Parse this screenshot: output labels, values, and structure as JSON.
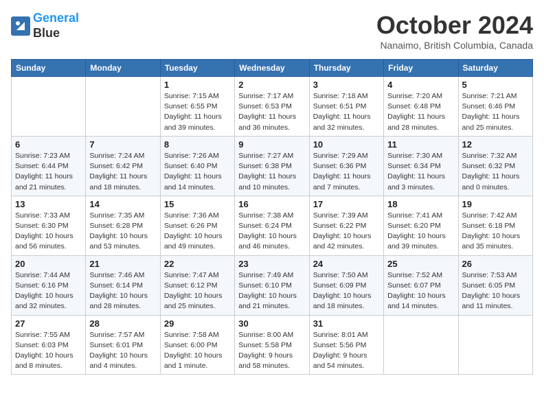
{
  "header": {
    "logo_line1": "General",
    "logo_line2": "Blue",
    "month": "October 2024",
    "location": "Nanaimo, British Columbia, Canada"
  },
  "weekdays": [
    "Sunday",
    "Monday",
    "Tuesday",
    "Wednesday",
    "Thursday",
    "Friday",
    "Saturday"
  ],
  "weeks": [
    [
      {
        "day": "",
        "info": ""
      },
      {
        "day": "",
        "info": ""
      },
      {
        "day": "1",
        "info": "Sunrise: 7:15 AM\nSunset: 6:55 PM\nDaylight: 11 hours and 39 minutes."
      },
      {
        "day": "2",
        "info": "Sunrise: 7:17 AM\nSunset: 6:53 PM\nDaylight: 11 hours and 36 minutes."
      },
      {
        "day": "3",
        "info": "Sunrise: 7:18 AM\nSunset: 6:51 PM\nDaylight: 11 hours and 32 minutes."
      },
      {
        "day": "4",
        "info": "Sunrise: 7:20 AM\nSunset: 6:48 PM\nDaylight: 11 hours and 28 minutes."
      },
      {
        "day": "5",
        "info": "Sunrise: 7:21 AM\nSunset: 6:46 PM\nDaylight: 11 hours and 25 minutes."
      }
    ],
    [
      {
        "day": "6",
        "info": "Sunrise: 7:23 AM\nSunset: 6:44 PM\nDaylight: 11 hours and 21 minutes."
      },
      {
        "day": "7",
        "info": "Sunrise: 7:24 AM\nSunset: 6:42 PM\nDaylight: 11 hours and 18 minutes."
      },
      {
        "day": "8",
        "info": "Sunrise: 7:26 AM\nSunset: 6:40 PM\nDaylight: 11 hours and 14 minutes."
      },
      {
        "day": "9",
        "info": "Sunrise: 7:27 AM\nSunset: 6:38 PM\nDaylight: 11 hours and 10 minutes."
      },
      {
        "day": "10",
        "info": "Sunrise: 7:29 AM\nSunset: 6:36 PM\nDaylight: 11 hours and 7 minutes."
      },
      {
        "day": "11",
        "info": "Sunrise: 7:30 AM\nSunset: 6:34 PM\nDaylight: 11 hours and 3 minutes."
      },
      {
        "day": "12",
        "info": "Sunrise: 7:32 AM\nSunset: 6:32 PM\nDaylight: 11 hours and 0 minutes."
      }
    ],
    [
      {
        "day": "13",
        "info": "Sunrise: 7:33 AM\nSunset: 6:30 PM\nDaylight: 10 hours and 56 minutes."
      },
      {
        "day": "14",
        "info": "Sunrise: 7:35 AM\nSunset: 6:28 PM\nDaylight: 10 hours and 53 minutes."
      },
      {
        "day": "15",
        "info": "Sunrise: 7:36 AM\nSunset: 6:26 PM\nDaylight: 10 hours and 49 minutes."
      },
      {
        "day": "16",
        "info": "Sunrise: 7:38 AM\nSunset: 6:24 PM\nDaylight: 10 hours and 46 minutes."
      },
      {
        "day": "17",
        "info": "Sunrise: 7:39 AM\nSunset: 6:22 PM\nDaylight: 10 hours and 42 minutes."
      },
      {
        "day": "18",
        "info": "Sunrise: 7:41 AM\nSunset: 6:20 PM\nDaylight: 10 hours and 39 minutes."
      },
      {
        "day": "19",
        "info": "Sunrise: 7:42 AM\nSunset: 6:18 PM\nDaylight: 10 hours and 35 minutes."
      }
    ],
    [
      {
        "day": "20",
        "info": "Sunrise: 7:44 AM\nSunset: 6:16 PM\nDaylight: 10 hours and 32 minutes."
      },
      {
        "day": "21",
        "info": "Sunrise: 7:46 AM\nSunset: 6:14 PM\nDaylight: 10 hours and 28 minutes."
      },
      {
        "day": "22",
        "info": "Sunrise: 7:47 AM\nSunset: 6:12 PM\nDaylight: 10 hours and 25 minutes."
      },
      {
        "day": "23",
        "info": "Sunrise: 7:49 AM\nSunset: 6:10 PM\nDaylight: 10 hours and 21 minutes."
      },
      {
        "day": "24",
        "info": "Sunrise: 7:50 AM\nSunset: 6:09 PM\nDaylight: 10 hours and 18 minutes."
      },
      {
        "day": "25",
        "info": "Sunrise: 7:52 AM\nSunset: 6:07 PM\nDaylight: 10 hours and 14 minutes."
      },
      {
        "day": "26",
        "info": "Sunrise: 7:53 AM\nSunset: 6:05 PM\nDaylight: 10 hours and 11 minutes."
      }
    ],
    [
      {
        "day": "27",
        "info": "Sunrise: 7:55 AM\nSunset: 6:03 PM\nDaylight: 10 hours and 8 minutes."
      },
      {
        "day": "28",
        "info": "Sunrise: 7:57 AM\nSunset: 6:01 PM\nDaylight: 10 hours and 4 minutes."
      },
      {
        "day": "29",
        "info": "Sunrise: 7:58 AM\nSunset: 6:00 PM\nDaylight: 10 hours and 1 minute."
      },
      {
        "day": "30",
        "info": "Sunrise: 8:00 AM\nSunset: 5:58 PM\nDaylight: 9 hours and 58 minutes."
      },
      {
        "day": "31",
        "info": "Sunrise: 8:01 AM\nSunset: 5:56 PM\nDaylight: 9 hours and 54 minutes."
      },
      {
        "day": "",
        "info": ""
      },
      {
        "day": "",
        "info": ""
      }
    ]
  ]
}
